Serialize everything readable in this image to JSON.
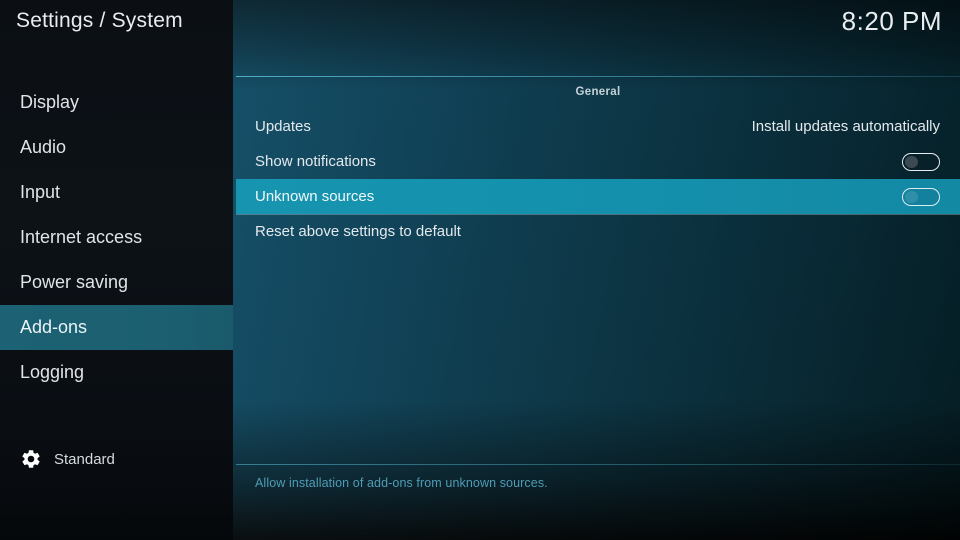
{
  "window": {
    "title": "Settings / System",
    "clock": "8:20 PM"
  },
  "sidebar": {
    "items": [
      {
        "label": "Display",
        "selected": false
      },
      {
        "label": "Audio",
        "selected": false
      },
      {
        "label": "Input",
        "selected": false
      },
      {
        "label": "Internet access",
        "selected": false
      },
      {
        "label": "Power saving",
        "selected": false
      },
      {
        "label": "Add-ons",
        "selected": true
      },
      {
        "label": "Logging",
        "selected": false
      }
    ],
    "profile": {
      "icon": "gear-icon",
      "label": "Standard"
    }
  },
  "main": {
    "group_title": "General",
    "rows": [
      {
        "label": "Updates",
        "type": "value",
        "value": "Install updates automatically",
        "selected": false
      },
      {
        "label": "Show notifications",
        "type": "toggle",
        "value": "off",
        "selected": false
      },
      {
        "label": "Unknown sources",
        "type": "toggle",
        "value": "off",
        "selected": true
      },
      {
        "label": "Reset above settings to default",
        "type": "action",
        "value": "",
        "selected": false
      }
    ],
    "help_text": "Allow installation of add-ons from unknown sources."
  },
  "colors": {
    "sidebar_selected": "#1d6274",
    "row_selected": "#1694b0",
    "help_text": "#4f9cb5",
    "content_bg": "#0b4158",
    "rule": "#5abed2"
  }
}
